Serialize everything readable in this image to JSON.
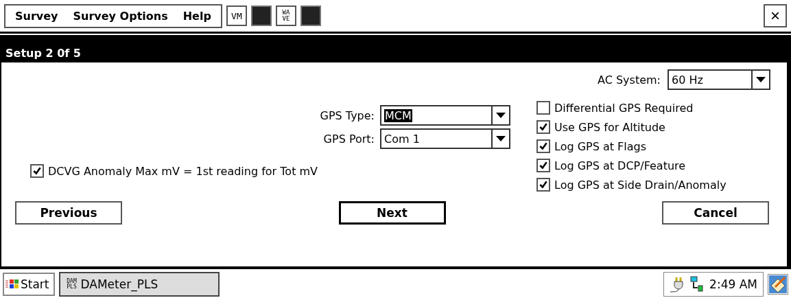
{
  "menu": [
    "Survey",
    "Survey Options",
    "Help"
  ],
  "toolbar": [
    {
      "kind": "text",
      "label": "VM"
    },
    {
      "kind": "filled"
    },
    {
      "kind": "text",
      "label": "WA VE"
    },
    {
      "kind": "filled"
    }
  ],
  "close": "×",
  "window": {
    "title": "Setup 2 0f 5"
  },
  "ac_system": {
    "label": "AC  System:",
    "value": "60 Hz"
  },
  "gps_type": {
    "label": "GPS Type:",
    "value": "MCM",
    "selected": true
  },
  "gps_port": {
    "label": "GPS Port:",
    "value": "Com 1",
    "selected": false
  },
  "options": [
    {
      "label": "Differential GPS Required",
      "checked": false
    },
    {
      "label": "Use GPS for Altitude",
      "checked": true
    },
    {
      "label": "Log GPS at Flags",
      "checked": true
    },
    {
      "label": "Log GPS at DCP/Feature",
      "checked": true
    },
    {
      "label": "Log GPS at Side Drain/Anomaly",
      "checked": true
    }
  ],
  "dcvg": {
    "label": "DCVG Anomaly Max mV = 1st reading for Tot mV",
    "checked": true
  },
  "buttons": [
    "Previous",
    "Next",
    "Cancel"
  ],
  "taskbar": {
    "start": "Start",
    "task": "DAMeter_PLS",
    "task_icon": "DAM PLS",
    "time": "2:49 AM"
  }
}
